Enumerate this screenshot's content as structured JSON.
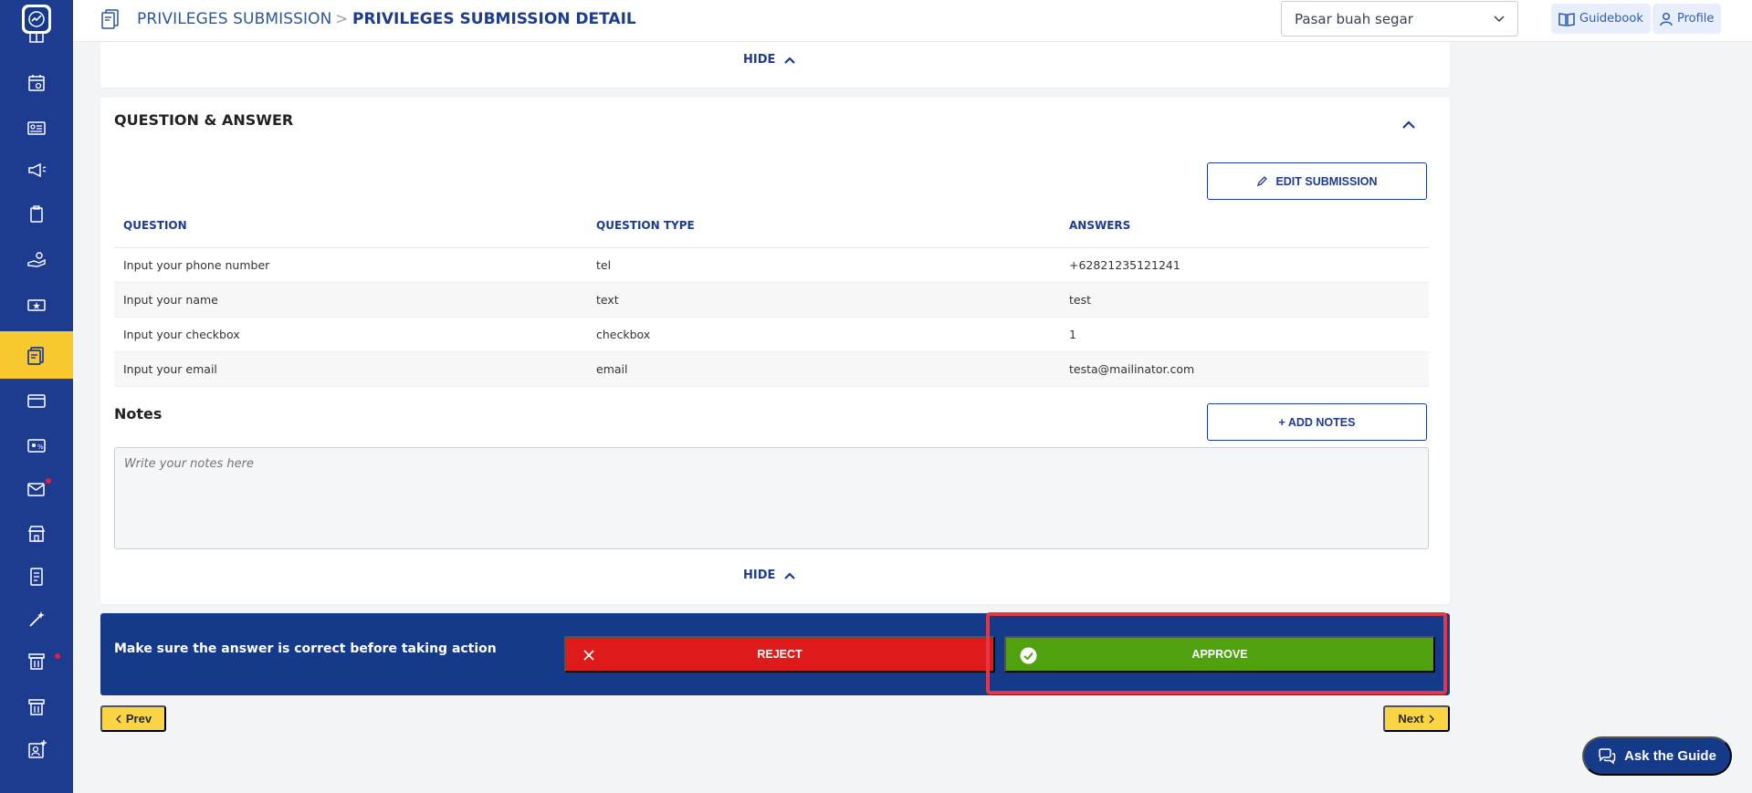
{
  "breadcrumb": {
    "parent": "PRIVILEGES SUBMISSION",
    "separator": ">",
    "current": "PRIVILEGES SUBMISSION DETAIL"
  },
  "header": {
    "store_select": {
      "selected": "Pasar buah segar"
    },
    "guidebook_label": "Guidebook",
    "profile_label": "Profile"
  },
  "top_card": {
    "hide_label": "HIDE"
  },
  "qa": {
    "title": "QUESTION & ANSWER",
    "edit_label": "EDIT SUBMISSION",
    "columns": [
      "QUESTION",
      "QUESTION TYPE",
      "ANSWERS"
    ],
    "rows": [
      [
        "Input your phone number",
        "tel",
        "+62821235121241"
      ],
      [
        "Input your name",
        "text",
        "test"
      ],
      [
        "Input your checkbox",
        "checkbox",
        "1"
      ],
      [
        "Input your email",
        "email",
        "testa@mailinator.com"
      ]
    ],
    "notes_title": "Notes",
    "add_notes_label": "+ ADD NOTES",
    "notes_placeholder": "Write your notes here",
    "hide_label": "HIDE"
  },
  "action_bar": {
    "message": "Make sure the answer is correct before taking action",
    "reject_label": "REJECT",
    "approve_label": "APPROVE"
  },
  "pagination": {
    "prev_label": "Prev",
    "next_label": "Next"
  },
  "ask_guide_label": "Ask the Guide",
  "colors": {
    "sidebar": "#1d3b8f",
    "active": "#f7c92f",
    "reject": "#de1a1a",
    "approve": "#4fa20d",
    "highlight": "#e33745"
  },
  "sidebar_icons": [
    "analytics-logo-icon",
    "gift-icon",
    "calendar-icon",
    "member-card-icon",
    "megaphone-icon",
    "clipboard-icon",
    "hand-coin-icon",
    "voucher-icon",
    "privileges-icon",
    "card-icon",
    "discount-card-icon",
    "mail-icon",
    "store-icon",
    "receipt-icon",
    "magic-wand-icon",
    "voucher-tower-icon",
    "voucher-tower-2-icon",
    "user-add-icon"
  ]
}
